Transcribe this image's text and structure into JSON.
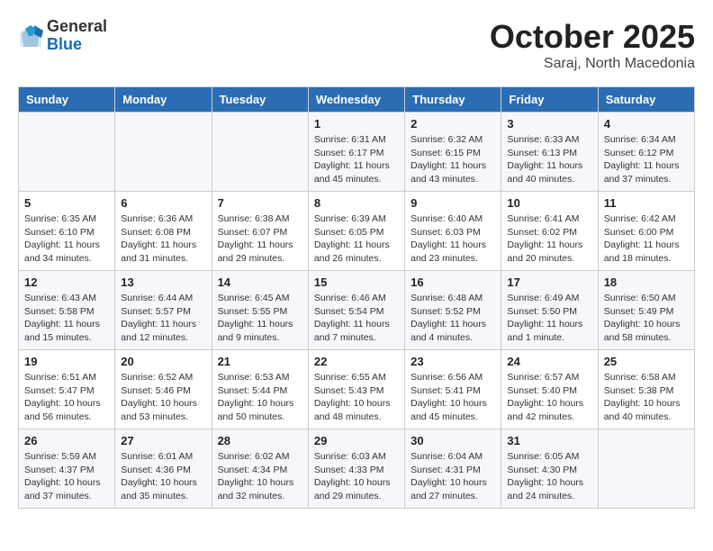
{
  "logo": {
    "general": "General",
    "blue": "Blue"
  },
  "header": {
    "month": "October 2025",
    "location": "Saraj, North Macedonia"
  },
  "weekdays": [
    "Sunday",
    "Monday",
    "Tuesday",
    "Wednesday",
    "Thursday",
    "Friday",
    "Saturday"
  ],
  "weeks": [
    [
      {
        "day": "",
        "info": ""
      },
      {
        "day": "",
        "info": ""
      },
      {
        "day": "",
        "info": ""
      },
      {
        "day": "1",
        "info": "Sunrise: 6:31 AM\nSunset: 6:17 PM\nDaylight: 11 hours\nand 45 minutes."
      },
      {
        "day": "2",
        "info": "Sunrise: 6:32 AM\nSunset: 6:15 PM\nDaylight: 11 hours\nand 43 minutes."
      },
      {
        "day": "3",
        "info": "Sunrise: 6:33 AM\nSunset: 6:13 PM\nDaylight: 11 hours\nand 40 minutes."
      },
      {
        "day": "4",
        "info": "Sunrise: 6:34 AM\nSunset: 6:12 PM\nDaylight: 11 hours\nand 37 minutes."
      }
    ],
    [
      {
        "day": "5",
        "info": "Sunrise: 6:35 AM\nSunset: 6:10 PM\nDaylight: 11 hours\nand 34 minutes."
      },
      {
        "day": "6",
        "info": "Sunrise: 6:36 AM\nSunset: 6:08 PM\nDaylight: 11 hours\nand 31 minutes."
      },
      {
        "day": "7",
        "info": "Sunrise: 6:38 AM\nSunset: 6:07 PM\nDaylight: 11 hours\nand 29 minutes."
      },
      {
        "day": "8",
        "info": "Sunrise: 6:39 AM\nSunset: 6:05 PM\nDaylight: 11 hours\nand 26 minutes."
      },
      {
        "day": "9",
        "info": "Sunrise: 6:40 AM\nSunset: 6:03 PM\nDaylight: 11 hours\nand 23 minutes."
      },
      {
        "day": "10",
        "info": "Sunrise: 6:41 AM\nSunset: 6:02 PM\nDaylight: 11 hours\nand 20 minutes."
      },
      {
        "day": "11",
        "info": "Sunrise: 6:42 AM\nSunset: 6:00 PM\nDaylight: 11 hours\nand 18 minutes."
      }
    ],
    [
      {
        "day": "12",
        "info": "Sunrise: 6:43 AM\nSunset: 5:58 PM\nDaylight: 11 hours\nand 15 minutes."
      },
      {
        "day": "13",
        "info": "Sunrise: 6:44 AM\nSunset: 5:57 PM\nDaylight: 11 hours\nand 12 minutes."
      },
      {
        "day": "14",
        "info": "Sunrise: 6:45 AM\nSunset: 5:55 PM\nDaylight: 11 hours\nand 9 minutes."
      },
      {
        "day": "15",
        "info": "Sunrise: 6:46 AM\nSunset: 5:54 PM\nDaylight: 11 hours\nand 7 minutes."
      },
      {
        "day": "16",
        "info": "Sunrise: 6:48 AM\nSunset: 5:52 PM\nDaylight: 11 hours\nand 4 minutes."
      },
      {
        "day": "17",
        "info": "Sunrise: 6:49 AM\nSunset: 5:50 PM\nDaylight: 11 hours\nand 1 minute."
      },
      {
        "day": "18",
        "info": "Sunrise: 6:50 AM\nSunset: 5:49 PM\nDaylight: 10 hours\nand 58 minutes."
      }
    ],
    [
      {
        "day": "19",
        "info": "Sunrise: 6:51 AM\nSunset: 5:47 PM\nDaylight: 10 hours\nand 56 minutes."
      },
      {
        "day": "20",
        "info": "Sunrise: 6:52 AM\nSunset: 5:46 PM\nDaylight: 10 hours\nand 53 minutes."
      },
      {
        "day": "21",
        "info": "Sunrise: 6:53 AM\nSunset: 5:44 PM\nDaylight: 10 hours\nand 50 minutes."
      },
      {
        "day": "22",
        "info": "Sunrise: 6:55 AM\nSunset: 5:43 PM\nDaylight: 10 hours\nand 48 minutes."
      },
      {
        "day": "23",
        "info": "Sunrise: 6:56 AM\nSunset: 5:41 PM\nDaylight: 10 hours\nand 45 minutes."
      },
      {
        "day": "24",
        "info": "Sunrise: 6:57 AM\nSunset: 5:40 PM\nDaylight: 10 hours\nand 42 minutes."
      },
      {
        "day": "25",
        "info": "Sunrise: 6:58 AM\nSunset: 5:38 PM\nDaylight: 10 hours\nand 40 minutes."
      }
    ],
    [
      {
        "day": "26",
        "info": "Sunrise: 5:59 AM\nSunset: 4:37 PM\nDaylight: 10 hours\nand 37 minutes."
      },
      {
        "day": "27",
        "info": "Sunrise: 6:01 AM\nSunset: 4:36 PM\nDaylight: 10 hours\nand 35 minutes."
      },
      {
        "day": "28",
        "info": "Sunrise: 6:02 AM\nSunset: 4:34 PM\nDaylight: 10 hours\nand 32 minutes."
      },
      {
        "day": "29",
        "info": "Sunrise: 6:03 AM\nSunset: 4:33 PM\nDaylight: 10 hours\nand 29 minutes."
      },
      {
        "day": "30",
        "info": "Sunrise: 6:04 AM\nSunset: 4:31 PM\nDaylight: 10 hours\nand 27 minutes."
      },
      {
        "day": "31",
        "info": "Sunrise: 6:05 AM\nSunset: 4:30 PM\nDaylight: 10 hours\nand 24 minutes."
      },
      {
        "day": "",
        "info": ""
      }
    ]
  ]
}
